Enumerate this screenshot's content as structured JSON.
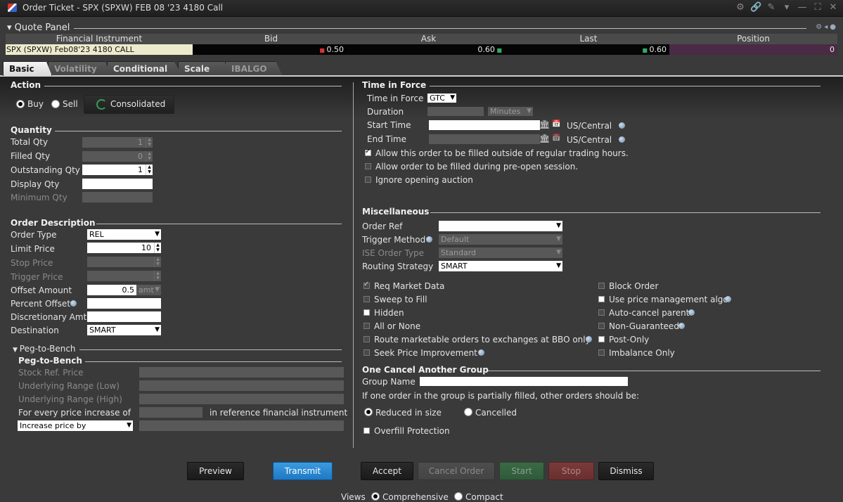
{
  "window": {
    "title": "Order Ticket - SPX (SPXW) FEB 08 '23 4180 Call"
  },
  "quote_panel": {
    "title": "Quote Panel",
    "columns": [
      "Financial Instrument",
      "Bid",
      "Ask",
      "Last",
      "Position"
    ],
    "row": {
      "instrument": "SPX (SPXW) Feb08'23 4180 CALL",
      "bid": "0.50",
      "ask": "0.60",
      "last": "0.60",
      "position": "0"
    }
  },
  "tabs": [
    "Basic",
    "Volatility",
    "Conditional",
    "Scale",
    "IBALGO"
  ],
  "action": {
    "title": "Action",
    "buy": "Buy",
    "sell": "Sell",
    "consolidated": "Consolidated"
  },
  "quantity": {
    "title": "Quantity",
    "total_qty_label": "Total Qty",
    "total_qty": "1",
    "filled_qty_label": "Filled Qty",
    "filled_qty": "0",
    "outstanding_qty_label": "Outstanding Qty",
    "outstanding_qty": "1",
    "display_qty_label": "Display Qty",
    "display_qty": "",
    "minimum_qty_label": "Minimum Qty",
    "minimum_qty": ""
  },
  "order_desc": {
    "title": "Order Description",
    "order_type_label": "Order Type",
    "order_type": "REL",
    "limit_price_label": "Limit Price",
    "limit_price": "10",
    "stop_price_label": "Stop Price",
    "trigger_price_label": "Trigger Price",
    "offset_amount_label": "Offset Amount",
    "offset_amount": "0.5",
    "offset_unit": "amt",
    "percent_offset_label": "Percent Offset",
    "discretionary_label": "Discretionary Amt",
    "destination_label": "Destination",
    "destination": "SMART"
  },
  "peg": {
    "collapse_title": "Peg-to-Bench",
    "title": "Peg-to-Bench",
    "stock_ref_label": "Stock Ref. Price",
    "range_low_label": "Underlying Range (Low)",
    "range_high_label": "Underlying Range (High)",
    "every_increase_label": "For every price increase of",
    "in_reference_label": "in reference financial instrument",
    "increase_select": "Increase price by"
  },
  "tif": {
    "title": "Time in Force",
    "tif_label": "Time in Force",
    "tif_value": "GTC",
    "duration_label": "Duration",
    "duration_unit": "Minutes",
    "start_label": "Start Time",
    "end_label": "End Time",
    "tz": "US/Central",
    "outside_rth": "Allow this order to be filled outside of regular trading hours.",
    "pre_open": "Allow order to be filled during pre-open session.",
    "ignore_auction": "Ignore opening auction"
  },
  "misc": {
    "title": "Miscellaneous",
    "order_ref_label": "Order Ref",
    "trigger_method_label": "Trigger Method",
    "trigger_method": "Default",
    "ise_label": "ISE Order Type",
    "ise_value": "Standard",
    "routing_label": "Routing Strategy",
    "routing_value": "SMART",
    "left_checks": [
      "Req Market Data",
      "Sweep to Fill",
      "Hidden",
      "All or None",
      "Route marketable orders to exchanges at BBO only",
      "Seek Price Improvement"
    ],
    "right_checks": [
      "Block Order",
      "Use price management algo",
      "Auto-cancel parent",
      "Non-Guaranteed",
      "Post-Only",
      "Imbalance Only"
    ]
  },
  "oca": {
    "title": "One Cancel Another Group",
    "group_name_label": "Group Name",
    "prompt": "If one order in the group is partially filled, other orders should be:",
    "reduced": "Reduced in size",
    "cancelled": "Cancelled",
    "overfill": "Overfill Protection"
  },
  "buttons": {
    "preview": "Preview",
    "transmit": "Transmit",
    "accept": "Accept",
    "cancel_order": "Cancel Order",
    "start": "Start",
    "stop": "Stop",
    "dismiss": "Dismiss"
  },
  "views": {
    "label": "Views",
    "comprehensive": "Comprehensive",
    "compact": "Compact"
  }
}
